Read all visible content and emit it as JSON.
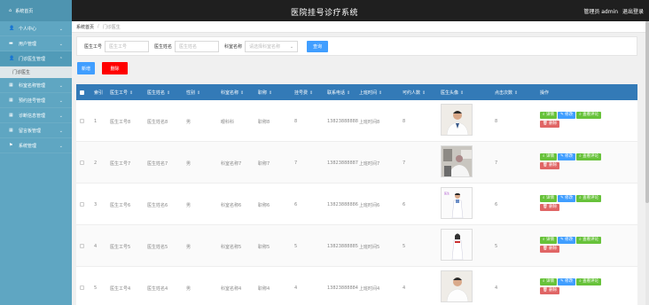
{
  "header": {
    "title": "医院挂号诊疗系统",
    "user_label": "管理员 admin",
    "logout": "退出登录"
  },
  "sidebar": {
    "home": "系统首页",
    "items": [
      {
        "icon": "👤",
        "label": "个人中心"
      },
      {
        "icon": "▬",
        "label": "用户管理"
      },
      {
        "icon": "👤",
        "label": "门诊医生管理"
      },
      {
        "icon": "▦",
        "label": "科室名称管理"
      },
      {
        "icon": "▦",
        "label": "预约挂号管理"
      },
      {
        "icon": "▦",
        "label": "诊断信息管理"
      },
      {
        "icon": "▦",
        "label": "留言板管理"
      },
      {
        "icon": "⚑",
        "label": "系统管理"
      }
    ],
    "sub_item": "门诊医生"
  },
  "breadcrumb": {
    "home": "系统首页",
    "current": "门诊医生"
  },
  "search": {
    "label1": "医生工号",
    "ph1": "医生工号",
    "label2": "医生姓名",
    "ph2": "医生姓名",
    "label3": "科室名称",
    "ph3": "请选择科室名称",
    "query": "查询"
  },
  "actions": {
    "add": "新增",
    "delete": "删除"
  },
  "table": {
    "headers": [
      "索引",
      "医生工号",
      "医生姓名",
      "性别",
      "科室名称",
      "职称",
      "挂号费",
      "联系电话",
      "上班时间",
      "可约人数",
      "医生头像",
      "点击次数",
      "操作"
    ],
    "rows": [
      {
        "idx": "1",
        "id": "医生工号8",
        "name": "医生姓名8",
        "sex": "男",
        "dept": "眼科科",
        "title": "职称8",
        "fee": "8",
        "phone": "13823888888",
        "time": "上班时间8",
        "avail": "8",
        "clicks": "8"
      },
      {
        "idx": "2",
        "id": "医生工号7",
        "name": "医生姓名7",
        "sex": "男",
        "dept": "科室名称7",
        "title": "职称7",
        "fee": "7",
        "phone": "13823888887",
        "time": "上班时间7",
        "avail": "7",
        "clicks": "7"
      },
      {
        "idx": "3",
        "id": "医生工号6",
        "name": "医生姓名6",
        "sex": "男",
        "dept": "科室名称6",
        "title": "职称6",
        "fee": "6",
        "phone": "13823888886",
        "time": "上班时间6",
        "avail": "6",
        "clicks": "6"
      },
      {
        "idx": "4",
        "id": "医生工号5",
        "name": "医生姓名5",
        "sex": "男",
        "dept": "科室名称5",
        "title": "职称5",
        "fee": "5",
        "phone": "13823888885",
        "time": "上班时间5",
        "avail": "5",
        "clicks": "5"
      },
      {
        "idx": "5",
        "id": "医生工号4",
        "name": "医生姓名4",
        "sex": "男",
        "dept": "科室名称4",
        "title": "职称4",
        "fee": "4",
        "phone": "13823888884",
        "time": "上班时间4",
        "avail": "4",
        "clicks": "4"
      }
    ],
    "ops": {
      "detail": "详情",
      "edit": "修改",
      "review": "查看评论",
      "delete": "删除"
    }
  },
  "colors": {
    "sidebar": "#5fa6c2",
    "header": "#1f1f1f",
    "table_head": "#337ab7",
    "primary": "#409eff",
    "danger": "#ff0000",
    "success": "#67c23a"
  }
}
